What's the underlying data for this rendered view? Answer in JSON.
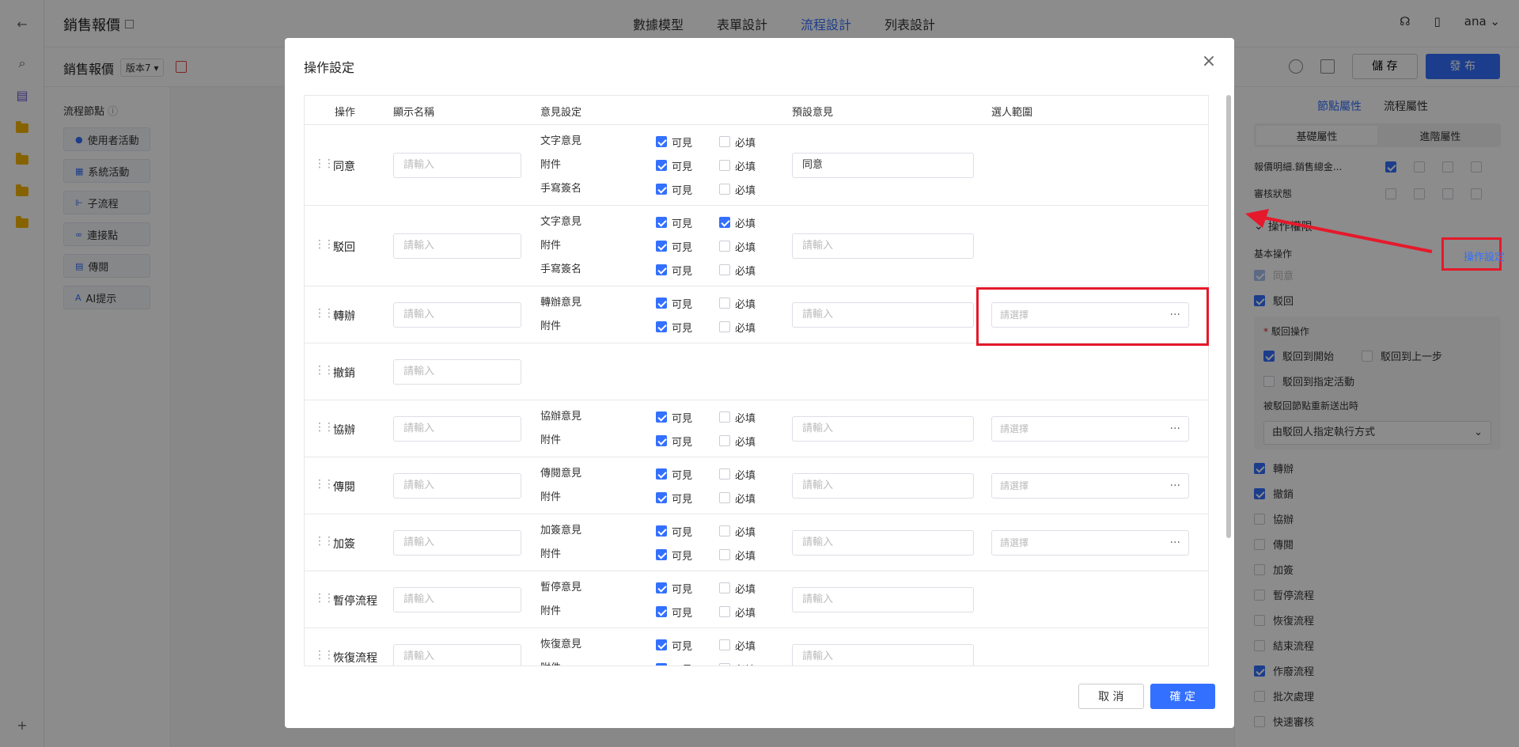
{
  "app": {
    "title": "銷售報價",
    "nav_tabs": [
      "數據模型",
      "表單設計",
      "流程設計",
      "列表設計"
    ],
    "active_tab": "流程設計",
    "user": "ana"
  },
  "subbar": {
    "title": "銷售報價",
    "version": "版本7",
    "save_label": "儲 存",
    "publish_label": "發 布"
  },
  "nodes_panel": {
    "title": "流程節點",
    "items": [
      "使用者活動",
      "系統活動",
      "子流程",
      "連接點",
      "傳閱",
      "AI提示"
    ]
  },
  "right_panel": {
    "tabs": [
      "節點屬性",
      "流程屬性"
    ],
    "segments": [
      "基礎屬性",
      "進階屬性"
    ],
    "field_rows": [
      "報價明細.銷售總金...",
      "審核狀態"
    ],
    "section_title": "操作權限",
    "basic_ops_label": "基本操作",
    "op_setting_link": "操作設定",
    "ops": [
      {
        "label": "同意",
        "checked": true,
        "disabled": true
      },
      {
        "label": "駁回",
        "checked": true
      }
    ],
    "reject_ops_label": "駁回操作",
    "reject_opts": [
      {
        "label": "駁回到開始",
        "checked": true
      },
      {
        "label": "駁回到上一步",
        "checked": false
      },
      {
        "label": "駁回到指定活動",
        "checked": false
      }
    ],
    "resend_label": "被駁回節點重新送出時",
    "resend_value": "由駁回人指定執行方式",
    "more_ops": [
      {
        "label": "轉辦",
        "checked": true
      },
      {
        "label": "撤銷",
        "checked": true
      },
      {
        "label": "協辦",
        "checked": false
      },
      {
        "label": "傳閱",
        "checked": false
      },
      {
        "label": "加簽",
        "checked": false
      },
      {
        "label": "暫停流程",
        "checked": false
      },
      {
        "label": "恢復流程",
        "checked": false
      },
      {
        "label": "結束流程",
        "checked": false
      },
      {
        "label": "作廢流程",
        "checked": true
      },
      {
        "label": "批次處理",
        "checked": false
      },
      {
        "label": "快速審核",
        "checked": false
      }
    ]
  },
  "modal": {
    "title": "操作設定",
    "columns": [
      "操作",
      "顯示名稱",
      "意見設定",
      "預設意見",
      "選人範圍"
    ],
    "input_placeholder": "請輸入",
    "select_placeholder": "請選擇",
    "visible_label": "可見",
    "required_label": "必填",
    "rows": [
      {
        "op": "同意",
        "opinions": [
          {
            "label": "文字意見",
            "visible": true,
            "required": false
          },
          {
            "label": "附件",
            "visible": true,
            "required": false
          },
          {
            "label": "手寫簽名",
            "visible": true,
            "required": false
          }
        ],
        "default_opinion": "同意",
        "has_scope": false
      },
      {
        "op": "駁回",
        "opinions": [
          {
            "label": "文字意見",
            "visible": true,
            "required": true
          },
          {
            "label": "附件",
            "visible": true,
            "required": false
          },
          {
            "label": "手寫簽名",
            "visible": true,
            "required": false
          }
        ],
        "default_opinion": "",
        "has_scope": false
      },
      {
        "op": "轉辦",
        "opinions": [
          {
            "label": "轉辦意見",
            "visible": true,
            "required": false
          },
          {
            "label": "附件",
            "visible": true,
            "required": false
          }
        ],
        "default_opinion": "",
        "has_scope": true
      },
      {
        "op": "撤銷",
        "opinions": [],
        "default_opinion": null,
        "has_scope": false
      },
      {
        "op": "協辦",
        "opinions": [
          {
            "label": "協辦意見",
            "visible": true,
            "required": false
          },
          {
            "label": "附件",
            "visible": true,
            "required": false
          }
        ],
        "default_opinion": "",
        "has_scope": true
      },
      {
        "op": "傳閱",
        "opinions": [
          {
            "label": "傳閱意見",
            "visible": true,
            "required": false
          },
          {
            "label": "附件",
            "visible": true,
            "required": false
          }
        ],
        "default_opinion": "",
        "has_scope": true
      },
      {
        "op": "加簽",
        "opinions": [
          {
            "label": "加簽意見",
            "visible": true,
            "required": false
          },
          {
            "label": "附件",
            "visible": true,
            "required": false
          }
        ],
        "default_opinion": "",
        "has_scope": true
      },
      {
        "op": "暫停流程",
        "opinions": [
          {
            "label": "暫停意見",
            "visible": true,
            "required": false
          },
          {
            "label": "附件",
            "visible": true,
            "required": false
          }
        ],
        "default_opinion": "",
        "has_scope": false
      },
      {
        "op": "恢復流程",
        "opinions": [
          {
            "label": "恢復意見",
            "visible": true,
            "required": false
          },
          {
            "label": "附件",
            "visible": true,
            "required": false
          }
        ],
        "default_opinion": "",
        "has_scope": false
      }
    ],
    "cancel_label": "取 消",
    "ok_label": "確 定"
  },
  "colors": {
    "primary": "#3370ff",
    "annotation": "#e5192b"
  }
}
